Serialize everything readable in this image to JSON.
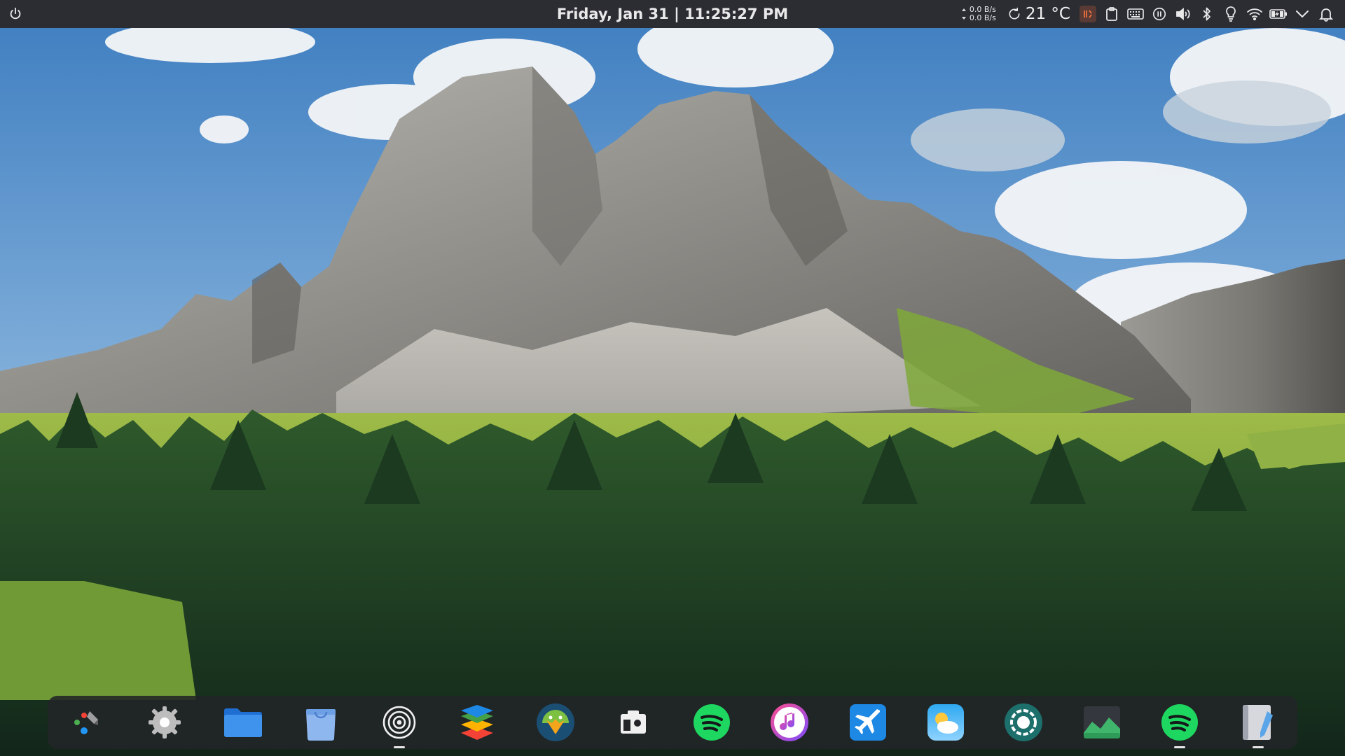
{
  "topbar": {
    "clock": "Friday, Jan 31 | 11:25:27 PM",
    "net_up": "0.0 B/s",
    "net_down": "0.0 B/s",
    "temperature": "21 °C",
    "bg_color": "#2b2d33"
  },
  "tray_icons": [
    "refresh-icon",
    "reading-mode-icon",
    "clipboard-icon",
    "keyboard-icon",
    "pause-icon",
    "volume-icon",
    "bluetooth-icon",
    "lightbulb-icon",
    "wifi-icon",
    "battery-icon",
    "chevron-down-icon",
    "notification-bell-icon"
  ],
  "dock": {
    "apps": [
      {
        "icon": "app-launcher-icon",
        "running": false
      },
      {
        "icon": "settings-gear-icon",
        "running": false
      },
      {
        "icon": "files-folder-icon",
        "running": false
      },
      {
        "icon": "software-store-icon",
        "running": false
      },
      {
        "icon": "circles-target-icon",
        "running": true
      },
      {
        "icon": "layers-stack-icon",
        "running": false
      },
      {
        "icon": "android-bird-icon",
        "running": false
      },
      {
        "icon": "photo-camera-icon",
        "running": false
      },
      {
        "icon": "spotify-icon",
        "running": false
      },
      {
        "icon": "music-note-icon",
        "running": false
      },
      {
        "icon": "airplane-icon",
        "running": false
      },
      {
        "icon": "weather-icon",
        "running": false
      },
      {
        "icon": "record-ring-icon",
        "running": false
      },
      {
        "icon": "image-landscape-icon",
        "running": false
      },
      {
        "icon": "spotify-icon",
        "running": true
      },
      {
        "icon": "text-editor-icon",
        "running": true
      }
    ]
  },
  "colors": {
    "sky_top": "#3f7fc0",
    "sky_bottom": "#a9c9e6",
    "forest": "#1f3a22",
    "meadow": "#6d9a3a",
    "rock": "#8f8e8a"
  }
}
